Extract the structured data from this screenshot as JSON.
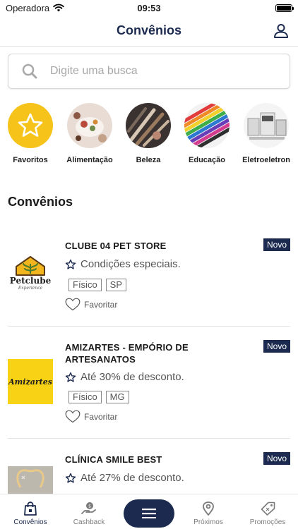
{
  "status_bar": {
    "carrier": "Operadora",
    "time": "09:53"
  },
  "header": {
    "title": "Convênios"
  },
  "search": {
    "placeholder": "Digite uma busca"
  },
  "categories": [
    {
      "label": "Favoritos",
      "icon": "star-icon"
    },
    {
      "label": "Alimentação",
      "icon": "food-photo"
    },
    {
      "label": "Beleza",
      "icon": "makeup-brushes-photo"
    },
    {
      "label": "Educação",
      "icon": "colored-pencils-photo"
    },
    {
      "label": "Eletroeletron",
      "icon": "appliances-photo"
    }
  ],
  "section": {
    "title": "Convênios"
  },
  "cards": [
    {
      "name": "CLUBE 04 PET STORE",
      "badge": "Novo",
      "offer": "Condições especiais.",
      "tags": [
        "Físico",
        "SP"
      ],
      "favorite_label": "Favoritar",
      "logo_text": "Petclube",
      "logo_subtext": "Experience"
    },
    {
      "name": "AMIZARTES - EMPÓRIO DE ARTESANATOS",
      "badge": "Novo",
      "offer": "Até 30% de desconto.",
      "tags": [
        "Físico",
        "MG"
      ],
      "favorite_label": "Favoritar",
      "logo_text": "Amizartes"
    },
    {
      "name": "CLÍNICA SMILE BEST",
      "badge": "Novo",
      "offer": "Até 27% de desconto."
    }
  ],
  "tab_bar": {
    "items": [
      {
        "label": "Convênios",
        "icon": "shopping-bag-icon",
        "active": true
      },
      {
        "label": "Cashback",
        "icon": "cashback-hand-icon",
        "active": false
      },
      {
        "label": "",
        "icon": "menu-icon",
        "active": false
      },
      {
        "label": "Próximos",
        "icon": "location-pin-icon",
        "active": false
      },
      {
        "label": "Promoções",
        "icon": "tag-icon",
        "active": false
      }
    ]
  },
  "colors": {
    "brand_navy": "#1b2a4e",
    "favorites_yellow": "#f6c31a"
  }
}
